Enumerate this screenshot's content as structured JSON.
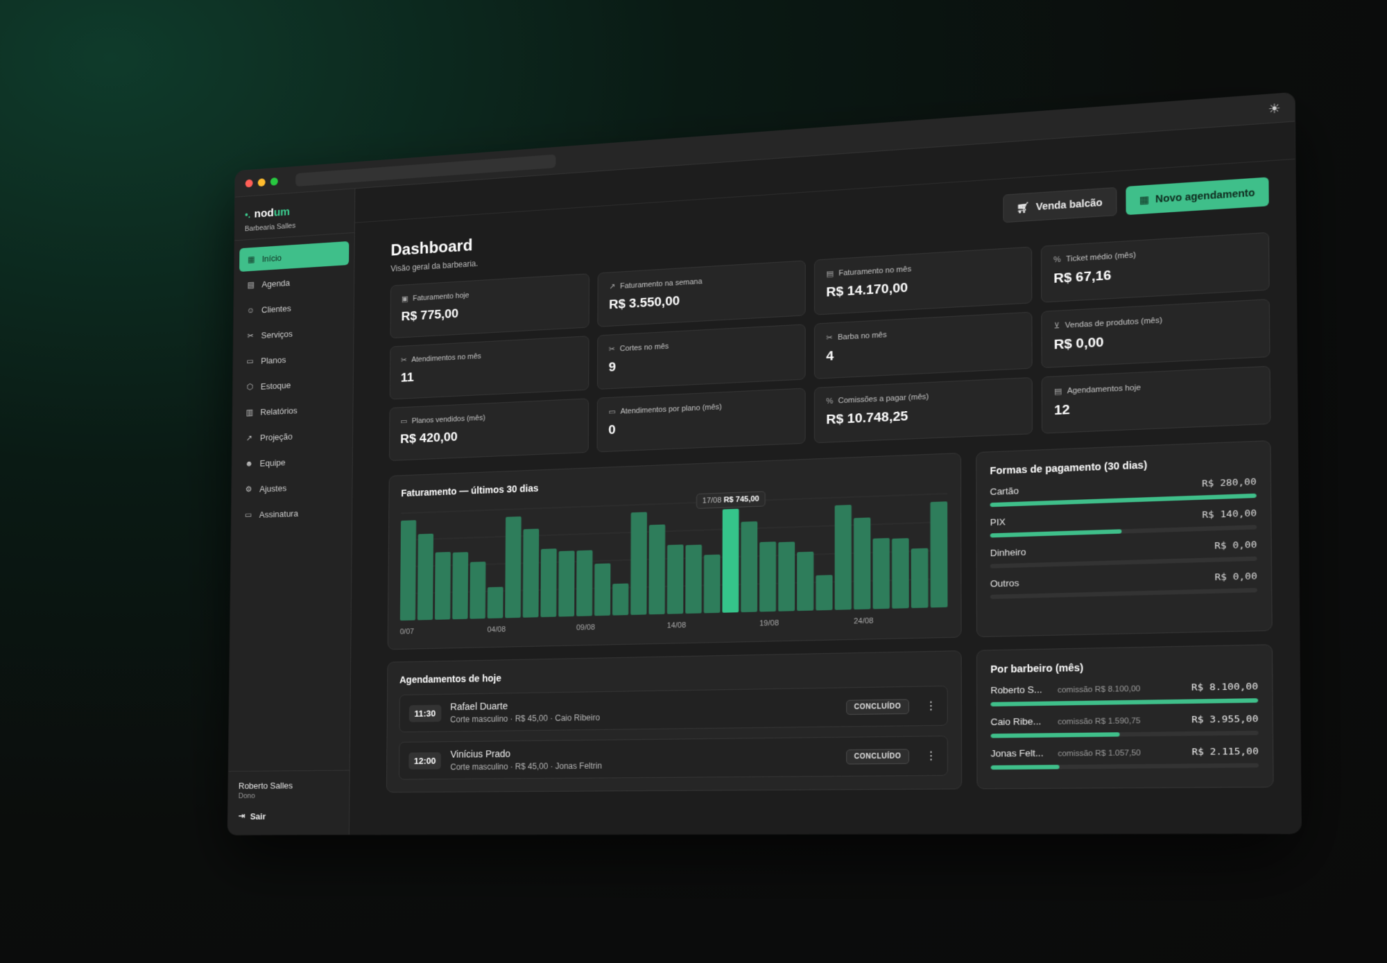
{
  "brand": {
    "name_a": "nod",
    "name_b": "um",
    "shop": "Barbearia Salles"
  },
  "nav": [
    {
      "label": "Início",
      "icon": "grid-icon",
      "active": true
    },
    {
      "label": "Agenda",
      "icon": "calendar-icon"
    },
    {
      "label": "Clientes",
      "icon": "users-icon"
    },
    {
      "label": "Serviços",
      "icon": "scissors-icon"
    },
    {
      "label": "Planos",
      "icon": "ticket-icon"
    },
    {
      "label": "Estoque",
      "icon": "box-icon"
    },
    {
      "label": "Relatórios",
      "icon": "bar-chart-icon"
    },
    {
      "label": "Projeção",
      "icon": "trend-icon"
    },
    {
      "label": "Equipe",
      "icon": "team-icon"
    },
    {
      "label": "Ajustes",
      "icon": "gear-icon"
    },
    {
      "label": "Assinatura",
      "icon": "card-icon"
    }
  ],
  "user": {
    "name": "Roberto Salles",
    "role": "Dono",
    "logout": "Sair"
  },
  "header": {
    "title": "Dashboard",
    "subtitle": "Visão geral da barbearia.",
    "btn_counter_sale": "Venda balcão",
    "btn_new_appointment": "Novo agendamento"
  },
  "kpis": [
    {
      "label": "Faturamento hoje",
      "value": "R$ 775,00",
      "icon": "cash-icon"
    },
    {
      "label": "Faturamento na semana",
      "value": "R$ 3.550,00",
      "icon": "trend-icon"
    },
    {
      "label": "Faturamento no mês",
      "value": "R$ 14.170,00",
      "icon": "receipt-icon"
    },
    {
      "label": "Ticket médio (mês)",
      "value": "R$ 67,16",
      "icon": "tag-icon"
    },
    {
      "label": "Atendimentos no mês",
      "value": "11",
      "icon": "scissors-icon"
    },
    {
      "label": "Cortes no mês",
      "value": "9",
      "icon": "scissors-icon"
    },
    {
      "label": "Barba no mês",
      "value": "4",
      "icon": "scissors-icon"
    },
    {
      "label": "Vendas de produtos (mês)",
      "value": "R$ 0,00",
      "icon": "cart-icon"
    },
    {
      "label": "Planos vendidos (mês)",
      "value": "R$ 420,00",
      "icon": "ticket-icon"
    },
    {
      "label": "Atendimentos por plano (mês)",
      "value": "0",
      "icon": "ticket-icon"
    },
    {
      "label": "Comissões a pagar (mês)",
      "value": "R$ 10.748,25",
      "icon": "percent-icon"
    },
    {
      "label": "Agendamentos hoje",
      "value": "12",
      "icon": "calendar-icon"
    }
  ],
  "revenue_chart": {
    "title": "Faturamento — últimos 30 dias",
    "tooltip_date": "17/08",
    "tooltip_value": "R$ 745,00",
    "highlight_index": 18,
    "colors": {
      "bar": "#2e7d5b",
      "highlight": "#35c48a"
    }
  },
  "chart_data": {
    "type": "bar",
    "categories": [
      "",
      "",
      "",
      "",
      "",
      "",
      "",
      "",
      "",
      "",
      "",
      "",
      "",
      "",
      "",
      "",
      "",
      "",
      "",
      "",
      "",
      "",
      "",
      "",
      "",
      "",
      "",
      "",
      "",
      ""
    ],
    "tick_labels": [
      "0/07",
      "04/08",
      "09/08",
      "14/08",
      "19/08",
      "24/08"
    ],
    "tick_indices": [
      0,
      5,
      10,
      15,
      20,
      25
    ],
    "values": [
      745,
      640,
      500,
      495,
      420,
      230,
      745,
      650,
      500,
      480,
      480,
      380,
      230,
      745,
      650,
      500,
      495,
      420,
      745,
      650,
      500,
      495,
      420,
      250,
      745,
      650,
      500,
      495,
      420,
      745
    ],
    "ylim": [
      0,
      800
    ]
  },
  "payments": {
    "title": "Formas de pagamento (30 dias)",
    "items": [
      {
        "label": "Cartão",
        "value": "R$ 280,00",
        "fraction": 1.0
      },
      {
        "label": "PIX",
        "value": "R$ 140,00",
        "fraction": 0.5
      },
      {
        "label": "Dinheiro",
        "value": "R$ 0,00",
        "fraction": 0
      },
      {
        "label": "Outros",
        "value": "R$ 0,00",
        "fraction": 0
      }
    ]
  },
  "today": {
    "title": "Agendamentos de hoje",
    "items": [
      {
        "time": "11:30",
        "name": "Rafael Duarte",
        "meta": "Corte masculino · R$ 45,00 · Caio Ribeiro",
        "status": "CONCLUÍDO"
      },
      {
        "time": "12:00",
        "name": "Vinícius Prado",
        "meta": "Corte masculino · R$ 45,00 · Jonas Feltrin",
        "status": "CONCLUÍDO"
      }
    ]
  },
  "barbers": {
    "title": "Por barbeiro (mês)",
    "items": [
      {
        "name": "Roberto S...",
        "commission": "comissão R$ 8.100,00",
        "total": "R$ 8.100,00",
        "fraction": 1.0
      },
      {
        "name": "Caio Ribe...",
        "commission": "comissão R$ 1.590,75",
        "total": "R$ 3.955,00",
        "fraction": 0.49
      },
      {
        "name": "Jonas Felt...",
        "commission": "comissão R$ 1.057,50",
        "total": "R$ 2.115,00",
        "fraction": 0.26
      }
    ]
  }
}
